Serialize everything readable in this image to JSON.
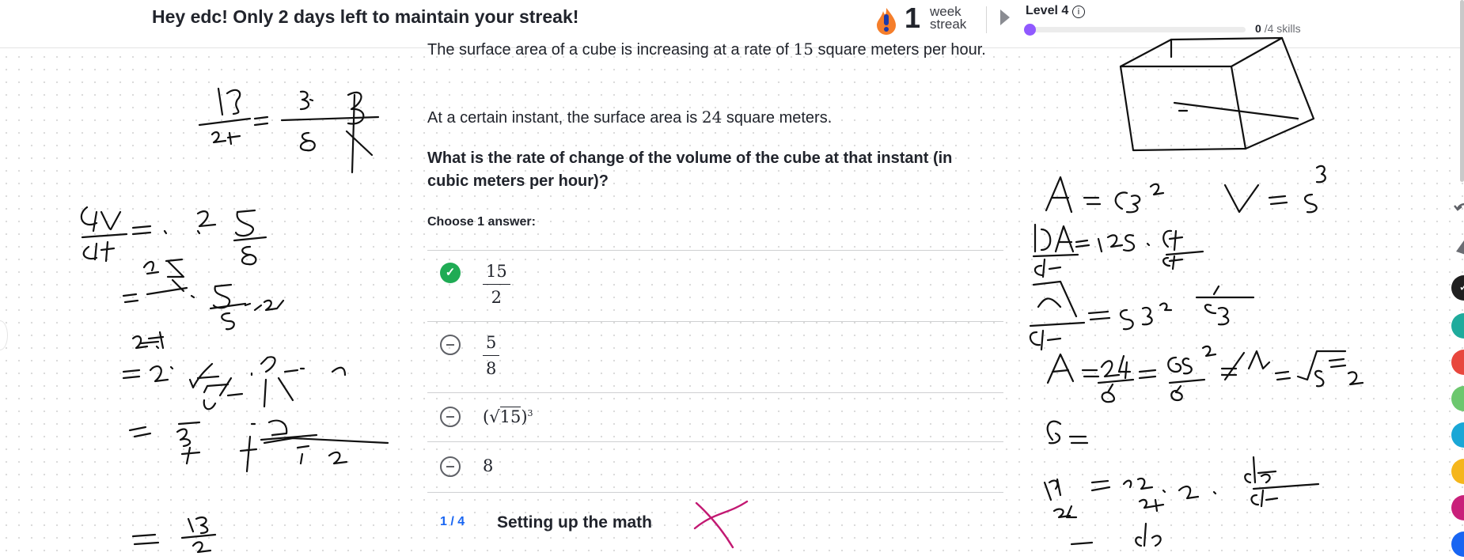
{
  "topbar": {
    "streak_message": "Hey edc! Only 2 days left to maintain your streak!",
    "streak_icon": "flame-icon",
    "streak_count": "1",
    "streak_unit_line1": "week",
    "streak_unit_line2": "streak",
    "level_label": "Level 4",
    "skills_done": "0",
    "skills_total": "/4 skills",
    "skills_progress": 0
  },
  "question": {
    "intro_text": "The surface area of a cube is increasing at a rate of",
    "intro_rate": "15",
    "intro_units": "square meters per hour.",
    "instant_text": "At a certain instant, the surface area is",
    "instant_value": "24",
    "instant_units": "square meters.",
    "ask": "What is the rate of change of the volume of the cube at that instant (in cubic meters per hour)?",
    "choose_label": "Choose 1 answer:"
  },
  "choices": [
    {
      "num": "15",
      "den": "2",
      "selected": true
    },
    {
      "num": "5",
      "den": "8",
      "selected": false
    },
    {
      "radicand": "15",
      "exponent": "3",
      "selected": false
    },
    {
      "value": "8",
      "selected": false
    }
  ],
  "footer": {
    "step_count": "1 / 4",
    "step_title": "Setting up the math"
  },
  "palette": {
    "accent_purple": "#9059ff",
    "correct_green": "#1fab54",
    "link_blue": "#1865f2",
    "tools": [
      "#1f1f1f",
      "#1fab9c",
      "#e8473d",
      "#6cc76e",
      "#1aa7d6",
      "#f5b61c",
      "#c9207a",
      "#1865f2"
    ]
  },
  "scratchpad": {
    "ink_color": "#111111",
    "mark_color": "#c21872"
  }
}
